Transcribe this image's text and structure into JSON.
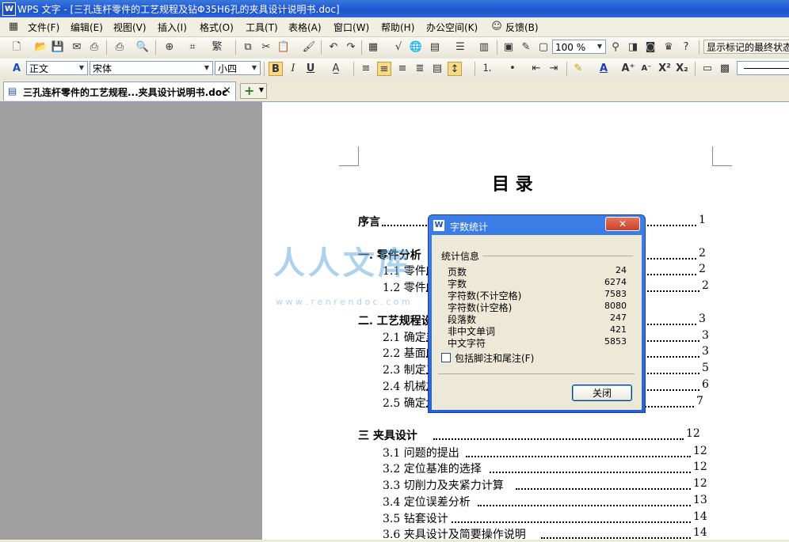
{
  "window": {
    "app_icon": "W",
    "title": "WPS 文字 - [三孔连杆零件的工艺规程及钻Φ35H6孔的夹具设计说明书.doc]"
  },
  "menu": [
    "文件(F)",
    "编辑(E)",
    "视图(V)",
    "插入(I)",
    "格式(O)",
    "工具(T)",
    "表格(A)",
    "窗口(W)",
    "帮助(H)",
    "办公空间(K)",
    "反馈(B)"
  ],
  "toolbar1": {
    "zoom": "100 %",
    "markup_mode": "显示标记的最终状态"
  },
  "toolbar2": {
    "style": "正文",
    "font": "宋体",
    "size": "小四",
    "bold": "B",
    "italic": "I",
    "underline": "U",
    "font_color_label": "A",
    "superscript": "X²",
    "subscript": "X₂"
  },
  "tab": {
    "label": "三孔连杆零件的工艺规程...夹具设计说明书.doc",
    "close": "×",
    "new_tab": "+"
  },
  "document": {
    "heading": "目      录",
    "toc": [
      {
        "text": "序言",
        "page": "1",
        "bold": true
      },
      {
        "text": "一.  零件分析",
        "page": "2",
        "bold": true
      },
      {
        "text": "1.1  零件的作用",
        "page": "2"
      },
      {
        "text": "1.2 零件的工艺分析",
        "page": "2"
      },
      {
        "text": "二.  工艺规程设计",
        "page": "3",
        "bold": true
      },
      {
        "text": "2.1 确定毛坯的制造形式",
        "page": "3"
      },
      {
        "text": "2.2 基面的选择",
        "page": "3"
      },
      {
        "text": "2.3 制定工艺路线",
        "page": "5"
      },
      {
        "text": "2.4 机械加工余量",
        "page": "6"
      },
      {
        "text": "2.5 确定切削用量",
        "page": "7"
      },
      {
        "text": "三   夹具设计",
        "page": "12",
        "bold": true
      },
      {
        "text": "3.1 问题的提出",
        "page": "12"
      },
      {
        "text": "3.2 定位基准的选择",
        "page": "12"
      },
      {
        "text": "3.3 切削力及夹紧力计算",
        "page": "12"
      },
      {
        "text": "3.4 定位误差分析",
        "page": "13"
      },
      {
        "text": "3.5 钻套设计",
        "page": "14"
      },
      {
        "text": "3.6 夹具设计及简要操作说明",
        "page": "14"
      }
    ]
  },
  "watermark": {
    "text": "人人文库",
    "url": "w w w . r e n r e n d o c . c o m"
  },
  "dialog": {
    "title": "字数统计",
    "section": "统计信息",
    "stats": [
      {
        "label": "页数",
        "value": "24"
      },
      {
        "label": "字数",
        "value": "6274"
      },
      {
        "label": "字符数(不计空格)",
        "value": "7583"
      },
      {
        "label": "字符数(计空格)",
        "value": "8080"
      },
      {
        "label": "段落数",
        "value": "247"
      },
      {
        "label": "非中文单词",
        "value": "421"
      },
      {
        "label": "中文字符",
        "value": "5853"
      }
    ],
    "checkbox_label": "包括脚注和尾注(F)",
    "close_button": "关闭"
  }
}
